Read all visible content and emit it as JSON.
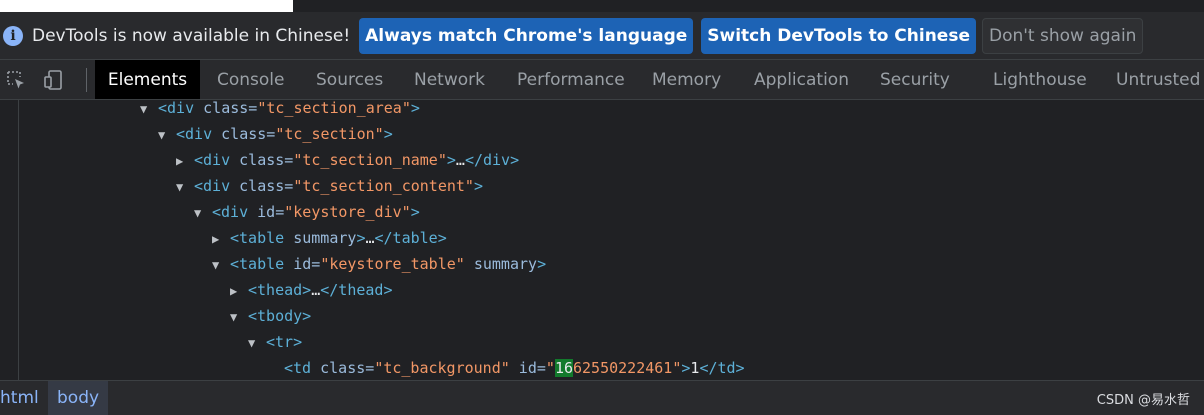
{
  "infobar": {
    "message": "DevTools is now available in Chinese!",
    "match_language_label": "Always match Chrome's language",
    "switch_label": "Switch DevTools to Chinese",
    "dismiss_label": "Don't show again",
    "info_glyph": "i"
  },
  "tabs": [
    {
      "label": "Elements",
      "active": true
    },
    {
      "label": "Console"
    },
    {
      "label": "Sources"
    },
    {
      "label": "Network"
    },
    {
      "label": "Performance"
    },
    {
      "label": "Memory"
    },
    {
      "label": "Application"
    },
    {
      "label": "Security"
    },
    {
      "label": "Lighthouse"
    },
    {
      "label": "Untrusted T"
    }
  ],
  "dom": {
    "l1": {
      "tag": "<div",
      "attr": " class=",
      "val": "\"tc_section_area\"",
      "close": ">"
    },
    "l2": {
      "tag": "<div",
      "attr": " class=",
      "val": "\"tc_section\"",
      "close": ">"
    },
    "l3": {
      "tag": "<div",
      "attr": " class=",
      "val": "\"tc_section_name\"",
      "close": ">",
      "ellipsis": "…",
      "end": "</div>"
    },
    "l4": {
      "tag": "<div",
      "attr": " class=",
      "val": "\"tc_section_content\"",
      "close": ">"
    },
    "l5": {
      "tag": "<div",
      "attr": " id=",
      "val": "\"keystore_div\"",
      "close": ">"
    },
    "l6": {
      "tag": "<table",
      "attr": " summary",
      "close": ">",
      "ellipsis": "…",
      "end": "</table>"
    },
    "l7": {
      "tag": "<table",
      "attr": " id=",
      "val": "\"keystore_table\"",
      "attr2": " summary",
      "close": ">"
    },
    "l8": {
      "tag": "<thead>",
      "ellipsis": "…",
      "end": "</thead>"
    },
    "l9": {
      "tag": "<tbody>"
    },
    "l10": {
      "tag": "<tr>"
    },
    "l11": {
      "tag": "<td",
      "attr": " class=",
      "val": "\"tc_background\"",
      "attr2": " id=",
      "val_q": "\"",
      "val_hl": "16",
      "val_rest": "62550222461\"",
      "close": ">",
      "text": "1",
      "end": "</td>"
    }
  },
  "breadcrumbs": [
    "html",
    "body"
  ],
  "watermark": "CSDN @易水哲"
}
